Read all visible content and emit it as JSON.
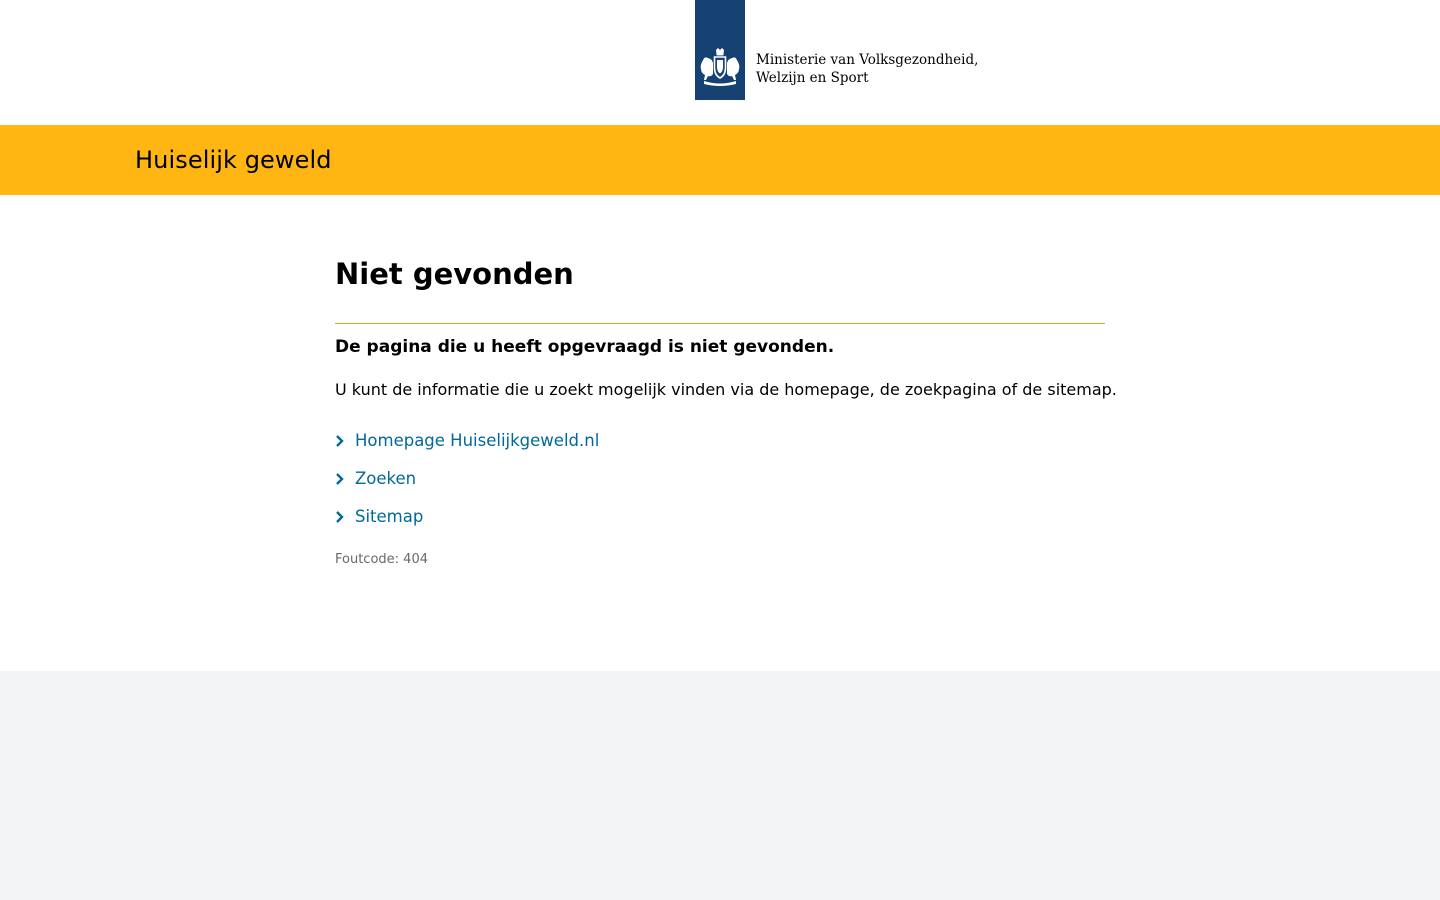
{
  "ministry": {
    "line1": "Ministerie van Volksgezondheid,",
    "line2": "Welzijn en Sport",
    "logo_color": "#154273",
    "emblem_icon": "rijksoverheid-lion-emblem-icon"
  },
  "banner": {
    "site_title": "Huiselijk geweld",
    "color": "#ffb612"
  },
  "main": {
    "title": "Niet gevonden",
    "lead": "De pagina die u heeft opgevraagd is niet gevonden.",
    "body": "U kunt de informatie die u zoekt mogelijk vinden via de homepage, de zoekpagina of de sitemap.",
    "links": [
      {
        "label": "Homepage Huiselijkgeweld.nl",
        "icon": "chevron-right-icon"
      },
      {
        "label": "Zoeken",
        "icon": "chevron-right-icon"
      },
      {
        "label": "Sitemap",
        "icon": "chevron-right-icon"
      }
    ],
    "error_code": "Foutcode: 404",
    "link_color": "#01689b",
    "divider_color": "#a9c41a"
  },
  "footer": {
    "background": "#f3f4f6"
  }
}
